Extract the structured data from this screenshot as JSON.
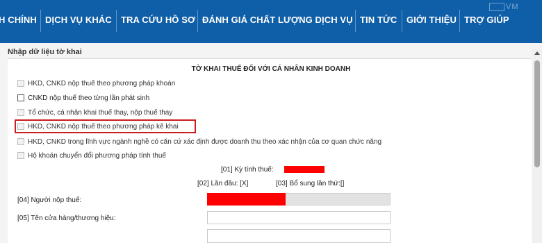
{
  "nav": {
    "items": [
      "H CHÍNH",
      "DỊCH VỤ KHÁC",
      "TRA CỨU HỒ SƠ",
      "ĐÁNH GIÁ CHẤT LƯỢNG DỊCH VỤ",
      "TIN TỨC",
      "GIỚI THIỆU",
      "TRỢ GIÚP"
    ],
    "background": "#0f5ea8",
    "watermark": "VM"
  },
  "panel": {
    "header": "Nhập dữ liệu tờ khai"
  },
  "form": {
    "title": "TỜ KHAI THUẾ ĐỐI VỚI CÁ NHÂN KINH DOANH",
    "options": [
      {
        "label": "HKD, CNKD nộp thuế theo phương pháp khoán",
        "checked": false,
        "enabled": false
      },
      {
        "label": "CNKD nộp thuế theo từng lần phát sinh",
        "checked": false,
        "enabled": true
      },
      {
        "label": "Tổ chức, cá nhân khai thuế thay, nộp thuế thay",
        "checked": false,
        "enabled": false
      },
      {
        "label": "HKD, CNKD nộp thuế theo phương pháp kê khai",
        "checked": false,
        "enabled": false,
        "highlighted": true
      },
      {
        "label": "HKD, CNKD trong lĩnh vực ngành nghề có căn cứ xác định được doanh thu theo xác nhận của cơ quan chức năng",
        "checked": false,
        "enabled": false
      },
      {
        "label": "Hộ khoán chuyển đổi phương pháp tính thuế",
        "checked": false,
        "enabled": false
      }
    ],
    "tax_period_label": "[01] Kỳ tính thuế:",
    "first_time_label": "[02] Lần đầu: [X]",
    "supplement_label": "[03] Bổ sung lần thứ:[]",
    "taxpayer_label": "[04] Người nộp thuế:",
    "store_name_label": "[05] Tên cửa hàng/thương hiệu:",
    "store_name_value": "",
    "redaction_color": "#ff0000",
    "highlight_color": "#c81e1e"
  }
}
